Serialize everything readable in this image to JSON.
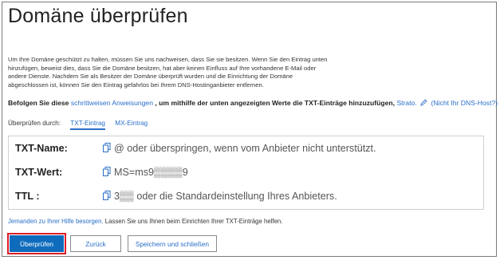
{
  "page": {
    "title": "Domäne überprüfen",
    "intro": "Um Ihre Domäne geschützt zu halten, müssen Sie uns nachweisen, dass Sie sie besitzen. Wenn Sie den Eintrag unten hinzufügen, beweist dies, dass Sie die Domäne besitzen, hat aber keinen Einfluss auf Ihre vorhandene E-Mail oder andere Dienste. Nachdem Sie als Besitzer der Domäne überprüft wurden und die Einrichtung der Domäne abgeschlossen ist, können Sie den Eintrag gefahrlos bei Ihrem DNS-Hostinganbieter entfernen."
  },
  "instructions": {
    "prefix": "Befolgen Sie diese",
    "link": "schrittweisen Anweisungen",
    "suffix": ", um mithilfe der unten angezeigten Werte die TXT-Einträge hinzuzufügen,",
    "provider": "Strato.",
    "not_host": "(Nicht Ihr DNS-Host?)"
  },
  "verify": {
    "label": "Überprüfen durch:",
    "tabs": [
      "TXT-Eintrag",
      "MX-Eintrag"
    ]
  },
  "records": [
    {
      "label": "TXT-Name:",
      "value": "@ oder überspringen, wenn vom Anbieter nicht unterstützt."
    },
    {
      "label": "TXT-Wert:",
      "value": "MS=ms9▒▒▒▒9"
    },
    {
      "label": "TTL :",
      "value": "3▒▒ oder die Standardeinstellung Ihres Anbieters."
    }
  ],
  "help": {
    "link": "Jemanden zu Ihrer Hilfe besorgen.",
    "text": " Lassen Sie uns Ihnen beim Einrichten Ihrer TXT-Einträge helfen."
  },
  "buttons": {
    "verify": "Überprüfen",
    "back": "Zurück",
    "save_close": "Speichern und schließen"
  },
  "colors": {
    "accent": "#0f6cbd",
    "link": "#2a6fc9",
    "highlight": "#e01b24"
  },
  "icons": {
    "copy": "copy-icon",
    "edit": "pencil-icon"
  }
}
